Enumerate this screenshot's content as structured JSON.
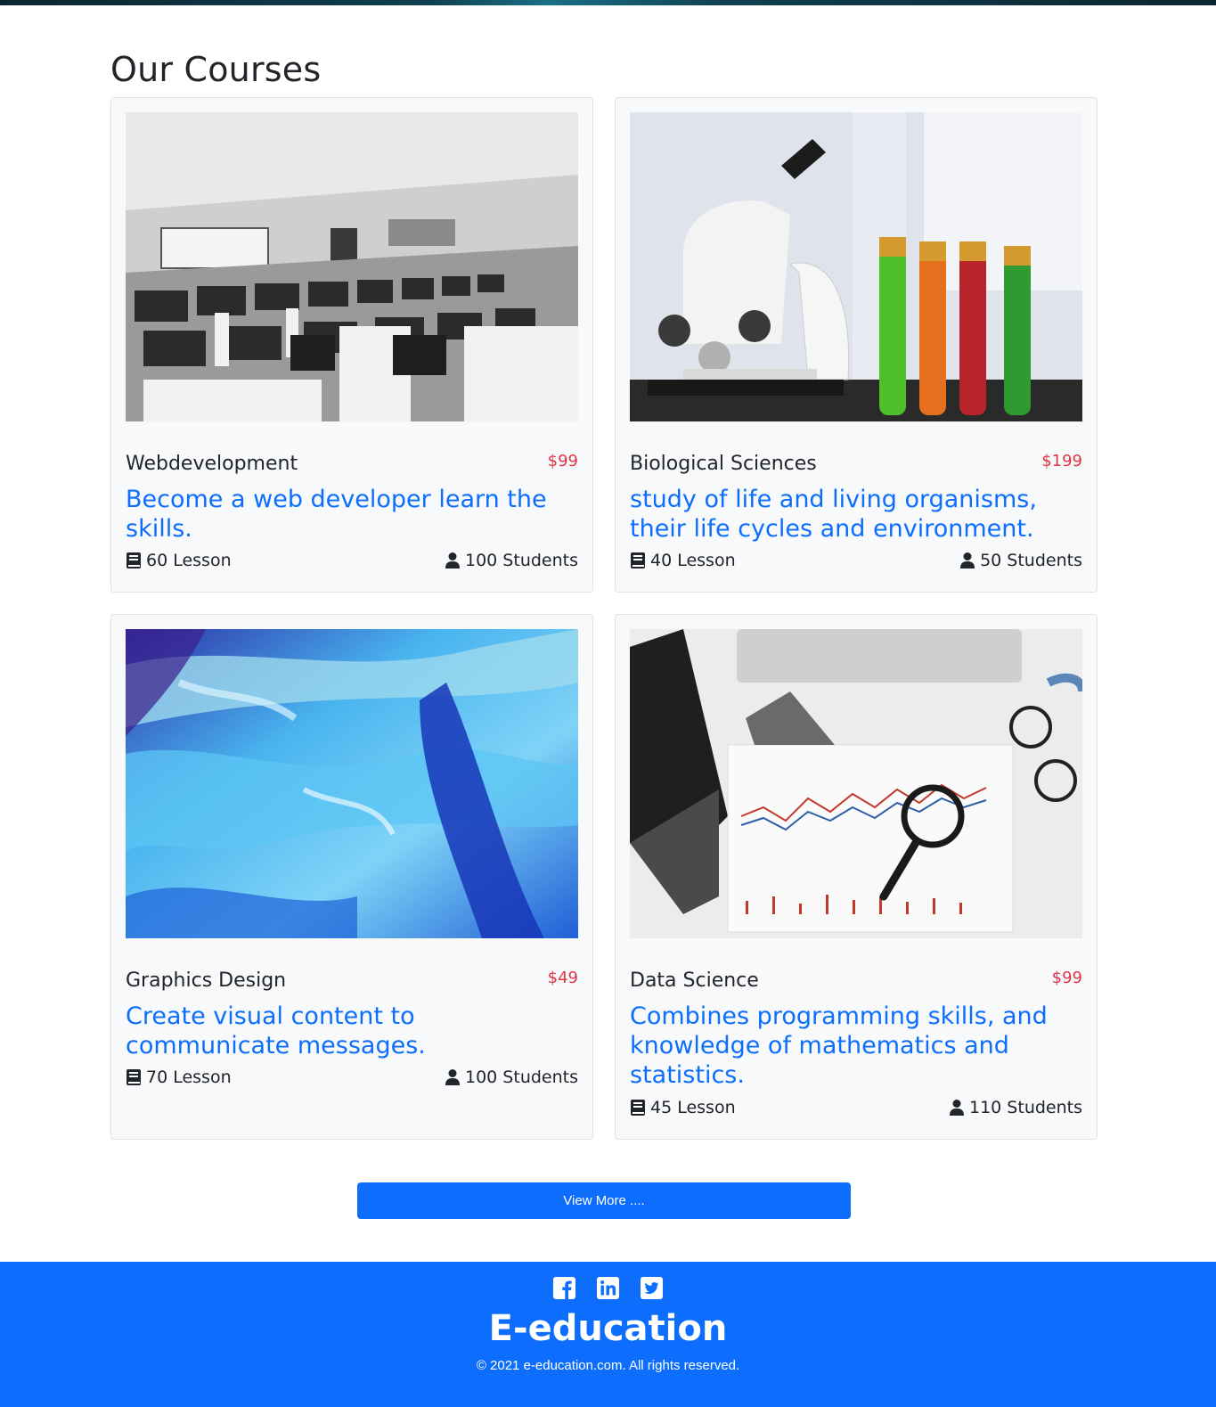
{
  "section": {
    "title": "Our Courses"
  },
  "courses": [
    {
      "name": "Webdevelopment",
      "price": "$99",
      "description": "Become a web developer learn the skills.",
      "lessons": "60 Lesson",
      "students": "100 Students",
      "image": "computer-lab-photo"
    },
    {
      "name": "Biological Sciences",
      "price": "$199",
      "description": "study of life and living organisms, their life cycles and environment.",
      "lessons": "40 Lesson",
      "students": "50 Students",
      "image": "microscope-photo"
    },
    {
      "name": "Graphics Design",
      "price": "$49",
      "description": "Create visual content to communicate messages.",
      "lessons": "70 Lesson",
      "students": "100 Students",
      "image": "blue-paint-photo"
    },
    {
      "name": "Data Science",
      "price": "$99",
      "description": "Combines programming skills, and knowledge of mathematics and statistics.",
      "lessons": "45 Lesson",
      "students": "110 Students",
      "image": "stock-chart-photo"
    }
  ],
  "view_more": {
    "label": "View More ...."
  },
  "footer": {
    "socials": [
      "facebook-icon",
      "linkedin-icon",
      "twitter-icon"
    ],
    "brand": "E-education",
    "copyright": "© 2021 e-education.com. All rights reserved."
  },
  "colors": {
    "primary": "#0d6efd",
    "price": "#dc3545",
    "text": "#212529",
    "card_bg": "#f8f9fa"
  }
}
